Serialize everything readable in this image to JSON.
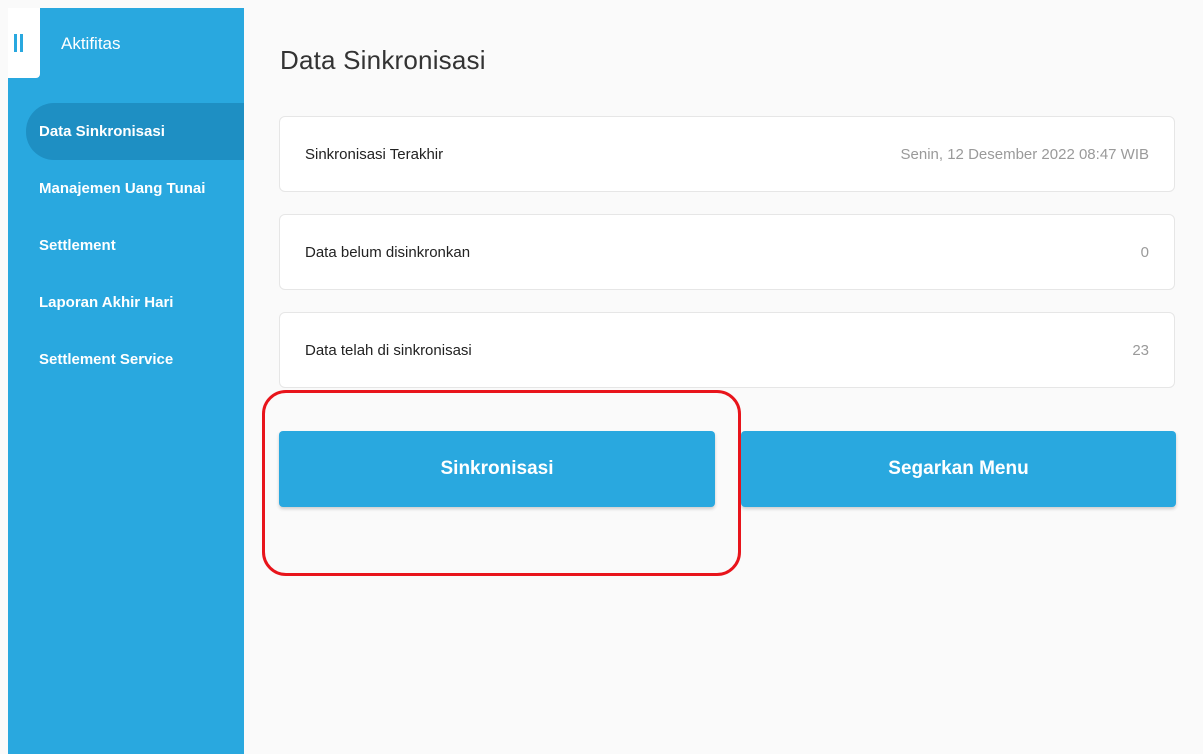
{
  "sidebar": {
    "title": "Aktifitas",
    "toggle_icon": "pause-bars-icon",
    "items": [
      {
        "label": "Data Sinkronisasi",
        "active": true
      },
      {
        "label": "Manajemen Uang Tunai",
        "active": false
      },
      {
        "label": "Settlement",
        "active": false
      },
      {
        "label": "Laporan Akhir Hari",
        "active": false
      },
      {
        "label": "Settlement Service",
        "active": false
      }
    ]
  },
  "main": {
    "title": "Data Sinkronisasi",
    "rows": [
      {
        "label": "Sinkronisasi Terakhir",
        "value": "Senin, 12 Desember 2022 08:47 WIB"
      },
      {
        "label": "Data belum disinkronkan",
        "value": "0"
      },
      {
        "label": "Data telah di sinkronisasi",
        "value": "23"
      }
    ],
    "buttons": {
      "sync_label": "Sinkronisasi",
      "refresh_label": "Segarkan Menu"
    }
  },
  "colors": {
    "accent": "#29a8df",
    "active_item": "#1e8fc3",
    "highlight": "#e8141b",
    "background": "#fafafa"
  }
}
